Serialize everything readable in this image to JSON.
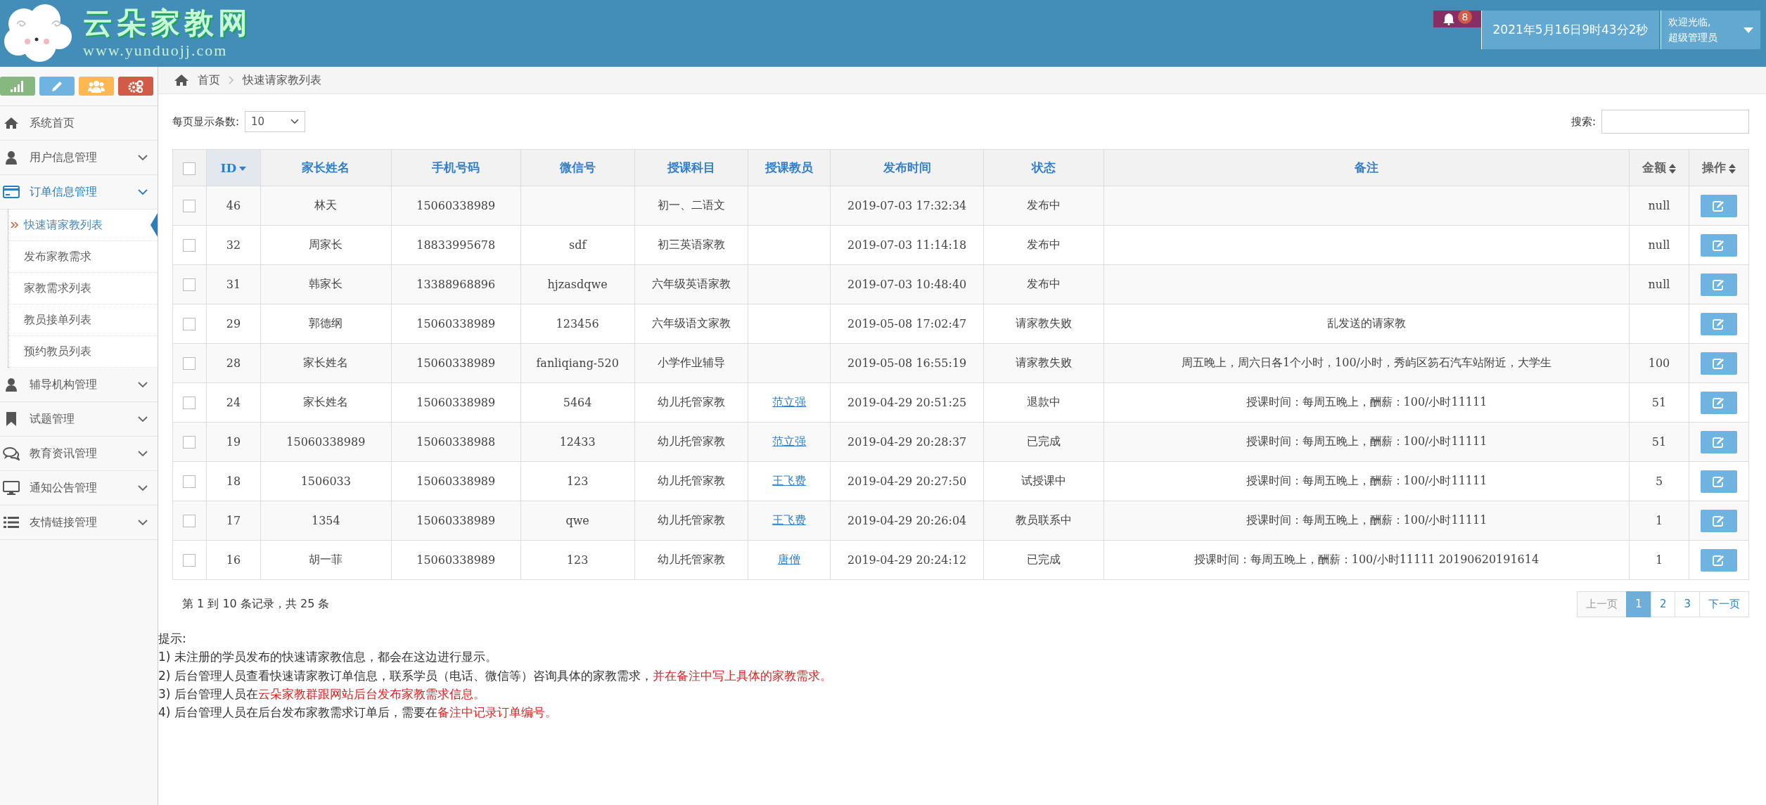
{
  "header": {
    "logo_title": "云朵家教网",
    "logo_url": "www.yunduojj.com",
    "notifications": {
      "count": "8"
    },
    "datetime": "2021年5月16日9时43分2秒",
    "welcome": "欢迎光临,",
    "role": "超级管理员"
  },
  "sidebar": {
    "shortcuts": [
      {
        "kind": "chart"
      },
      {
        "kind": "pencil"
      },
      {
        "kind": "users"
      },
      {
        "kind": "cogs"
      }
    ],
    "items": [
      {
        "label": "系统首页",
        "kind": "home",
        "expandable": false,
        "selected": false
      },
      {
        "label": "用户信息管理",
        "kind": "user",
        "expandable": true,
        "selected": false
      },
      {
        "label": "订单信息管理",
        "kind": "card",
        "expandable": true,
        "selected": true,
        "children": [
          {
            "label": "快速请家教列表",
            "selected": true
          },
          {
            "label": "发布家教需求",
            "selected": false
          },
          {
            "label": "家教需求列表",
            "selected": false
          },
          {
            "label": "教员接单列表",
            "selected": false
          },
          {
            "label": "预约教员列表",
            "selected": false
          }
        ]
      },
      {
        "label": "辅导机构管理",
        "kind": "user",
        "expandable": true,
        "selected": false
      },
      {
        "label": "试题管理",
        "kind": "bookmark",
        "expandable": true,
        "selected": false
      },
      {
        "label": "教育资讯管理",
        "kind": "comments",
        "expandable": true,
        "selected": false
      },
      {
        "label": "通知公告管理",
        "kind": "desktop",
        "expandable": true,
        "selected": false
      },
      {
        "label": "友情链接管理",
        "kind": "list",
        "expandable": true,
        "selected": false
      }
    ]
  },
  "breadcrumb": [
    "首页",
    "快速请家教列表"
  ],
  "page_size": {
    "label": "每页显示条数:",
    "value": "10"
  },
  "search": {
    "label": "搜索:"
  },
  "table": {
    "select_all": {
      "checked": false
    },
    "columns": [
      {
        "label": "ID",
        "kind": "sorted"
      },
      {
        "label": "家长姓名",
        "kind": "link"
      },
      {
        "label": "手机号码",
        "kind": "link"
      },
      {
        "label": "微信号",
        "kind": "link"
      },
      {
        "label": "授课科目",
        "kind": "link"
      },
      {
        "label": "授课教员",
        "kind": "link"
      },
      {
        "label": "发布时间",
        "kind": "link"
      },
      {
        "label": "状态",
        "kind": "link"
      },
      {
        "label": "备注",
        "kind": "link"
      },
      {
        "label": "金额",
        "kind": "sortable"
      },
      {
        "label": "操作",
        "kind": "sortable"
      }
    ],
    "rows": [
      {
        "checked": false,
        "id": "46",
        "parent": "林天",
        "phone": "15060338989",
        "wechat": "",
        "subject": "初一、二语文",
        "teacher": "",
        "time": "2019-07-03 17:32:34",
        "status": "发布中",
        "note": "",
        "amount": "null"
      },
      {
        "checked": false,
        "id": "32",
        "parent": "周家长",
        "phone": "18833995678",
        "wechat": "sdf",
        "subject": "初三英语家教",
        "teacher": "",
        "time": "2019-07-03 11:14:18",
        "status": "发布中",
        "note": "",
        "amount": "null"
      },
      {
        "checked": false,
        "id": "31",
        "parent": "韩家长",
        "phone": "13388968896",
        "wechat": "hjzasdqwe",
        "subject": "六年级英语家教",
        "teacher": "",
        "time": "2019-07-03 10:48:40",
        "status": "发布中",
        "note": "",
        "amount": "null"
      },
      {
        "checked": false,
        "id": "29",
        "parent": "郭德纲",
        "phone": "15060338989",
        "wechat": "123456",
        "subject": "六年级语文家教",
        "teacher": "",
        "time": "2019-05-08 17:02:47",
        "status": "请家教失败",
        "note": "乱发送的请家教",
        "amount": ""
      },
      {
        "checked": false,
        "id": "28",
        "parent": "家长姓名",
        "phone": "15060338989",
        "wechat": "fanliqiang-520",
        "subject": "小学作业辅导",
        "teacher": "",
        "time": "2019-05-08 16:55:19",
        "status": "请家教失败",
        "note": "周五晚上，周六日各1个小时，100/小时，秀屿区笏石汽车站附近，大学生",
        "amount": "100"
      },
      {
        "checked": false,
        "id": "24",
        "parent": "家长姓名",
        "phone": "15060338989",
        "wechat": "5464",
        "subject": "幼儿托管家教",
        "teacher": "范立强",
        "time": "2019-04-29 20:51:25",
        "status": "退款中",
        "note": "授课时间：每周五晚上，酬薪：100/小时11111",
        "amount": "51"
      },
      {
        "checked": false,
        "id": "19",
        "parent": "15060338989",
        "phone": "15060338988",
        "wechat": "12433",
        "subject": "幼儿托管家教",
        "teacher": "范立强",
        "time": "2019-04-29 20:28:37",
        "status": "已完成",
        "note": "授课时间：每周五晚上，酬薪：100/小时11111",
        "amount": "51"
      },
      {
        "checked": false,
        "id": "18",
        "parent": "1506033",
        "phone": "15060338989",
        "wechat": "123",
        "subject": "幼儿托管家教",
        "teacher": "王飞费",
        "time": "2019-04-29 20:27:50",
        "status": "试授课中",
        "note": "授课时间：每周五晚上，酬薪：100/小时11111",
        "amount": "5"
      },
      {
        "checked": false,
        "id": "17",
        "parent": "1354",
        "phone": "15060338989",
        "wechat": "qwe",
        "subject": "幼儿托管家教",
        "teacher": "王飞费",
        "time": "2019-04-29 20:26:04",
        "status": "教员联系中",
        "note": "授课时间：每周五晚上，酬薪：100/小时11111",
        "amount": "1"
      },
      {
        "checked": false,
        "id": "16",
        "parent": "胡一菲",
        "phone": "15060338989",
        "wechat": "123",
        "subject": "幼儿托管家教",
        "teacher": "唐僧",
        "time": "2019-04-29 20:24:12",
        "status": "已完成",
        "note": "授课时间：每周五晚上，酬薪：100/小时11111 20190620191614",
        "amount": "1"
      }
    ]
  },
  "table_info": "第 1 到 10 条记录，共 25 条",
  "pagination": [
    {
      "label": "上一页",
      "disabled": true,
      "selected": false
    },
    {
      "label": "1",
      "disabled": false,
      "selected": true
    },
    {
      "label": "2",
      "disabled": false,
      "selected": false
    },
    {
      "label": "3",
      "disabled": false,
      "selected": false
    },
    {
      "label": "下一页",
      "disabled": false,
      "selected": false
    }
  ],
  "tips": {
    "title": "提示:",
    "lines": [
      [
        {
          "text": "1) 未注册的学员发布的快速请家教信息，都会在这边进行显示。",
          "kind": "plain"
        }
      ],
      [
        {
          "text": "2) 后台管理人员查看快速请家教订单信息，联系学员（电话、微信等）咨询具体的家教需求，",
          "kind": "plain"
        },
        {
          "text": "并在备注中写上具体的家教需求。",
          "kind": "highlight"
        }
      ],
      [
        {
          "text": "3) 后台管理人员在",
          "kind": "plain"
        },
        {
          "text": "云朵家教群跟网站后台发布家教需求信息。",
          "kind": "highlight"
        }
      ],
      [
        {
          "text": "4) 后台管理人员在后台发布家教需求订单后，需要在",
          "kind": "plain"
        },
        {
          "text": "备注中记录订单编号。",
          "kind": "highlight"
        }
      ]
    ]
  }
}
